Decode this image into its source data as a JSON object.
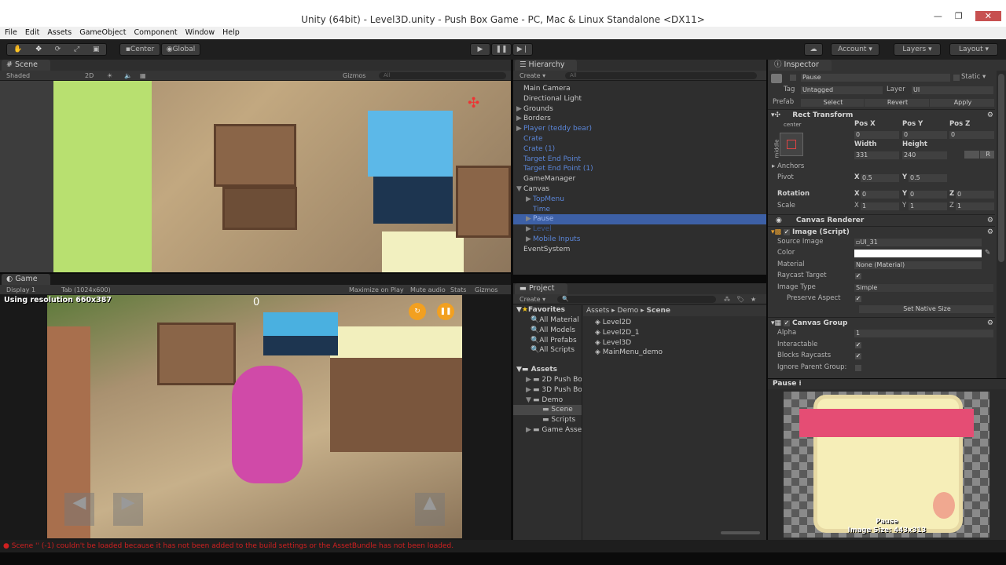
{
  "window": {
    "title": "Unity (64bit) - Level3D.unity - Push Box Game - PC, Mac & Linux Standalone <DX11>",
    "controls": [
      "—",
      "❐",
      "✕"
    ]
  },
  "menu": [
    "File",
    "Edit",
    "Assets",
    "GameObject",
    "Component",
    "Window",
    "Help"
  ],
  "toolbar": {
    "center": "Center",
    "global": "Global",
    "account": "Account",
    "layers": "Layers",
    "layout": "Layout"
  },
  "scene": {
    "tab": "Scene",
    "shading": "Shaded",
    "mode2d": "2D",
    "gizmos": "Gizmos",
    "search": "All"
  },
  "game": {
    "tab": "Game",
    "display": "Display 1",
    "resolution": "Tab (1024x600)",
    "maximize": "Maximize on Play",
    "mute": "Mute audio",
    "stats": "Stats",
    "gizmos": "Gizmos",
    "overlay": "Using resolution 660x387",
    "score": "0"
  },
  "hierarchy": {
    "tab": "Hierarchy",
    "create": "Create",
    "search": "All",
    "items": [
      {
        "label": "Main Camera",
        "style": "",
        "indent": 0,
        "arrow": ""
      },
      {
        "label": "Directional Light",
        "style": "",
        "indent": 0,
        "arrow": ""
      },
      {
        "label": "Grounds",
        "style": "",
        "indent": 0,
        "arrow": "▶"
      },
      {
        "label": "Borders",
        "style": "",
        "indent": 0,
        "arrow": "▶"
      },
      {
        "label": "Player (teddy bear)",
        "style": "blue",
        "indent": 0,
        "arrow": "▶"
      },
      {
        "label": "Crate",
        "style": "blue",
        "indent": 0,
        "arrow": ""
      },
      {
        "label": "Crate (1)",
        "style": "blue",
        "indent": 0,
        "arrow": ""
      },
      {
        "label": "Target End Point",
        "style": "blue",
        "indent": 0,
        "arrow": ""
      },
      {
        "label": "Target End Point (1)",
        "style": "blue",
        "indent": 0,
        "arrow": ""
      },
      {
        "label": "GameManager",
        "style": "",
        "indent": 0,
        "arrow": ""
      },
      {
        "label": "Canvas",
        "style": "",
        "indent": 0,
        "arrow": "▼"
      },
      {
        "label": "TopMenu",
        "style": "blue",
        "indent": 1,
        "arrow": "▶"
      },
      {
        "label": "Time",
        "style": "blue",
        "indent": 1,
        "arrow": ""
      },
      {
        "label": "Pause",
        "style": "sel",
        "indent": 1,
        "arrow": "▶"
      },
      {
        "label": "Level",
        "style": "dim",
        "indent": 1,
        "arrow": "▶"
      },
      {
        "label": "Mobile Inputs",
        "style": "blue",
        "indent": 1,
        "arrow": "▶"
      },
      {
        "label": "EventSystem",
        "style": "",
        "indent": 0,
        "arrow": ""
      }
    ]
  },
  "project": {
    "tab": "Project",
    "create": "Create",
    "favorites": "Favorites",
    "fav_items": [
      "All Material",
      "All Models",
      "All Prefabs",
      "All Scripts"
    ],
    "assets": "Assets",
    "tree": [
      {
        "label": "2D Push Bo",
        "indent": 1,
        "arrow": "▶"
      },
      {
        "label": "3D Push Bo",
        "indent": 1,
        "arrow": "▶"
      },
      {
        "label": "Demo",
        "indent": 1,
        "arrow": "▼"
      },
      {
        "label": "Scene",
        "indent": 2,
        "arrow": "",
        "sel": true
      },
      {
        "label": "Scripts",
        "indent": 2,
        "arrow": ""
      },
      {
        "label": "Game Asse",
        "indent": 1,
        "arrow": "▶"
      }
    ],
    "breadcrumb": [
      "Assets",
      "Demo",
      "Scene"
    ],
    "files": [
      "Level2D",
      "Level2D_1",
      "Level3D",
      "MainMenu_demo"
    ]
  },
  "inspector": {
    "tab": "Inspector",
    "name": "Pause",
    "static": "Static",
    "tag_label": "Tag",
    "tag": "Untagged",
    "layer_label": "Layer",
    "layer": "UI",
    "prefab": "Prefab",
    "select": "Select",
    "revert": "Revert",
    "apply": "Apply",
    "rect": {
      "title": "Rect Transform",
      "anchor_h": "center",
      "anchor_v": "middle",
      "posx_l": "Pos X",
      "posy_l": "Pos Y",
      "posz_l": "Pos Z",
      "posx": "0",
      "posy": "0",
      "posz": "0",
      "width_l": "Width",
      "height_l": "Height",
      "width": "331",
      "height": "240",
      "r": "R",
      "anchors": "Anchors",
      "pivot": "Pivot",
      "pivot_x": "0.5",
      "pivot_y": "0.5",
      "rotation": "Rotation",
      "rot_x": "0",
      "rot_y": "0",
      "rot_z": "0",
      "scale": "Scale",
      "sc_x": "1",
      "sc_y": "1",
      "sc_z": "1",
      "x": "X",
      "y": "Y",
      "z": "Z"
    },
    "canvas_renderer": "Canvas Renderer",
    "image": {
      "title": "Image (Script)",
      "source_l": "Source Image",
      "source": "UI_31",
      "color_l": "Color",
      "color": "#ffffff",
      "material_l": "Material",
      "material": "None (Material)",
      "raycast_l": "Raycast Target",
      "type_l": "Image Type",
      "type": "Simple",
      "preserve_l": "Preserve Aspect",
      "native": "Set Native Size"
    },
    "canvas_group": {
      "title": "Canvas Group",
      "alpha_l": "Alpha",
      "alpha": "1",
      "interact_l": "Interactable",
      "blocks_l": "Blocks Raycasts",
      "ignore_l": "Ignore Parent Group:"
    },
    "preview": {
      "title": "Pause",
      "name": "Pause",
      "size": "Image Size: 443x313"
    }
  },
  "status": {
    "message": "Scene '' (-1) couldn't be loaded because it has not been added to the build settings or the AssetBundle has not been loaded.",
    "color": "#d02020"
  }
}
